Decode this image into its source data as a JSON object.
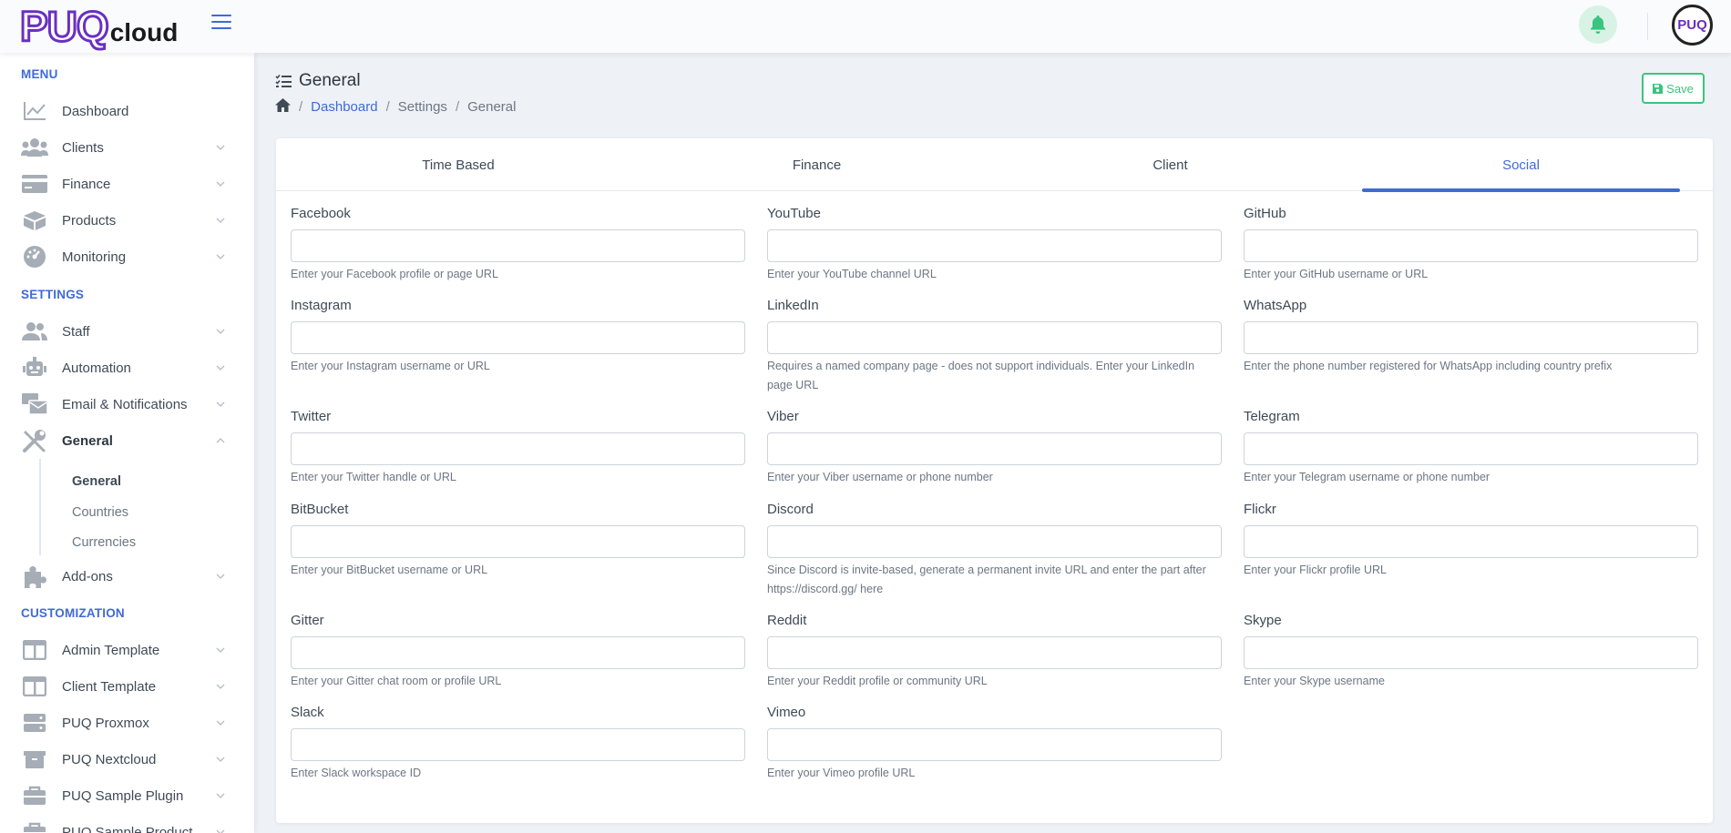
{
  "header": {
    "logo_big": "PUQ",
    "logo_small": "cloud",
    "avatar_text": "PUQ"
  },
  "sidebar": {
    "sections": [
      {
        "label": "MENU"
      },
      {
        "label": "SETTINGS"
      },
      {
        "label": "CUSTOMIZATION"
      }
    ],
    "items": [
      {
        "label": "Dashboard",
        "icon": "chart-line-icon"
      },
      {
        "label": "Clients",
        "icon": "users-icon"
      },
      {
        "label": "Finance",
        "icon": "credit-card-icon"
      },
      {
        "label": "Products",
        "icon": "box-icon"
      },
      {
        "label": "Monitoring",
        "icon": "gauge-icon"
      },
      {
        "label": "Staff",
        "icon": "user-group-icon"
      },
      {
        "label": "Automation",
        "icon": "robot-icon"
      },
      {
        "label": "Email & Notifications",
        "icon": "mail-bulk-icon"
      },
      {
        "label": "General",
        "icon": "tools-icon"
      },
      {
        "label": "Add-ons",
        "icon": "puzzle-icon"
      },
      {
        "label": "Admin Template",
        "icon": "columns-icon"
      },
      {
        "label": "Client Template",
        "icon": "columns-icon"
      },
      {
        "label": "PUQ Proxmox",
        "icon": "server-icon"
      },
      {
        "label": "PUQ Nextcloud",
        "icon": "box-open-icon"
      },
      {
        "label": "PUQ Sample Plugin",
        "icon": "briefcase-icon"
      },
      {
        "label": "PUQ Sample Product",
        "icon": "briefcase-icon"
      }
    ],
    "subitems": [
      {
        "label": "General"
      },
      {
        "label": "Countries"
      },
      {
        "label": "Currencies"
      }
    ]
  },
  "page": {
    "title": "General",
    "breadcrumb": [
      "Dashboard",
      "Settings",
      "General"
    ],
    "save_label": "Save"
  },
  "tabs": [
    {
      "label": "Time Based"
    },
    {
      "label": "Finance"
    },
    {
      "label": "Client"
    },
    {
      "label": "Social"
    }
  ],
  "fields": [
    {
      "label": "Facebook",
      "help": "Enter your Facebook profile or page URL",
      "value": ""
    },
    {
      "label": "YouTube",
      "help": "Enter your YouTube channel URL",
      "value": ""
    },
    {
      "label": "GitHub",
      "help": "Enter your GitHub username or URL",
      "value": ""
    },
    {
      "label": "Instagram",
      "help": "Enter your Instagram username or URL",
      "value": ""
    },
    {
      "label": "LinkedIn",
      "help": "Requires a named company page - does not support individuals. Enter your LinkedIn page URL",
      "value": ""
    },
    {
      "label": "WhatsApp",
      "help": "Enter the phone number registered for WhatsApp including country prefix",
      "value": ""
    },
    {
      "label": "Twitter",
      "help": "Enter your Twitter handle or URL",
      "value": ""
    },
    {
      "label": "Viber",
      "help": "Enter your Viber username or phone number",
      "value": ""
    },
    {
      "label": "Telegram",
      "help": "Enter your Telegram username or phone number",
      "value": ""
    },
    {
      "label": "BitBucket",
      "help": "Enter your BitBucket username or URL",
      "value": ""
    },
    {
      "label": "Discord",
      "help": "Since Discord is invite-based, generate a permanent invite URL and enter the part after https://discord.gg/ here",
      "value": ""
    },
    {
      "label": "Flickr",
      "help": "Enter your Flickr profile URL",
      "value": ""
    },
    {
      "label": "Gitter",
      "help": "Enter your Gitter chat room or profile URL",
      "value": ""
    },
    {
      "label": "Reddit",
      "help": "Enter your Reddit profile or community URL",
      "value": ""
    },
    {
      "label": "Skype",
      "help": "Enter your Skype username",
      "value": ""
    },
    {
      "label": "Slack",
      "help": "Enter Slack workspace ID",
      "value": ""
    },
    {
      "label": "Vimeo",
      "help": "Enter your Vimeo profile URL",
      "value": ""
    }
  ],
  "colors": {
    "accent": "#3f6ad8",
    "brand": "#6a2fc2",
    "success": "#3ac47d"
  }
}
